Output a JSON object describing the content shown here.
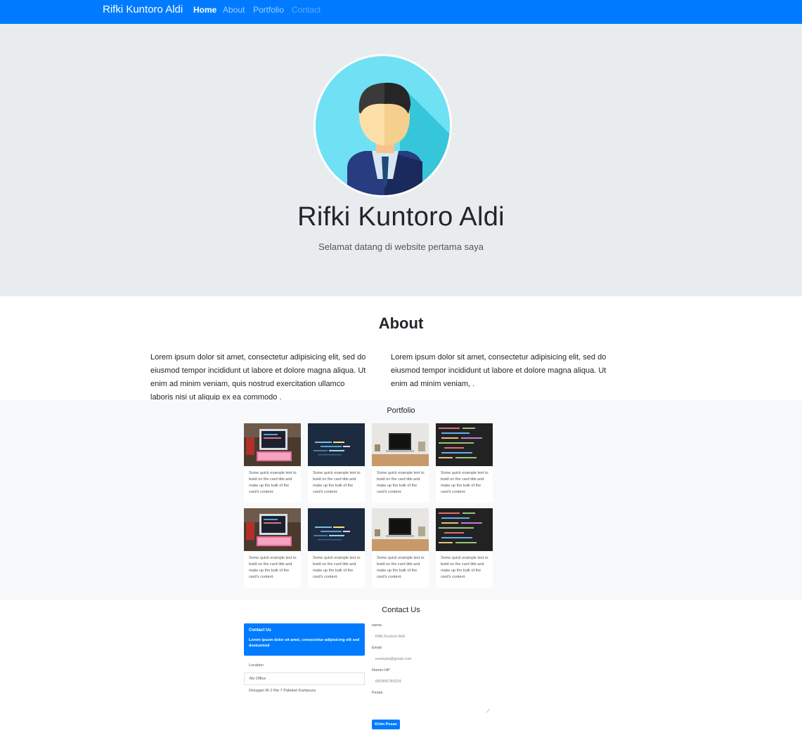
{
  "navbar": {
    "brand": "Rifki Kuntoro Aldi",
    "links": [
      {
        "label": "Home",
        "state": "active"
      },
      {
        "label": "About",
        "state": "muted"
      },
      {
        "label": "Portfolio",
        "state": "muted"
      },
      {
        "label": "Contact",
        "state": "dim"
      }
    ],
    "color": "#007bff"
  },
  "hero": {
    "name": "Rifki Kuntoro Aldi",
    "subtitle": "Selamat datang di website pertama saya",
    "avatar_icon": "businessman-avatar-icon"
  },
  "about": {
    "title": "About",
    "col1": "Lorem ipsum dolor sit amet, consectetur adipisicing elit, sed do eiusmod tempor incididunt ut labore et dolore magna aliqua. Ut enim ad minim veniam, quis nostrud exercitation ullamco laboris nisi ut aliquip ex ea commodo .",
    "col2": "Lorem ipsum dolor sit amet, consectetur adipisicing elit, sed do eiusmod tempor incididunt ut labore et dolore magna aliqua. Ut enim ad minim veniam, ."
  },
  "portfolio": {
    "title": "Portfolio",
    "card_text": "Some quick example text to build on the card title and make up the bulk of the card's content.",
    "cards": [
      {
        "image": "laptop-keyboard-image"
      },
      {
        "image": "code-screen-blue-image"
      },
      {
        "image": "macbook-desk-image"
      },
      {
        "image": "code-dark-image"
      },
      {
        "image": "laptop-keyboard-image"
      },
      {
        "image": "code-screen-blue-image"
      },
      {
        "image": "macbook-desk-image"
      },
      {
        "image": "code-dark-image"
      }
    ]
  },
  "contact": {
    "title": "Contact Us",
    "card_heading": "Contact Us",
    "card_text": "Lorem ipsum dolor sit amet, consectetur adipisicing elit sed doeiusmod",
    "location_label": "Location",
    "office": "My Office",
    "address": "Desagan Rt 2 Rw 7 Pabelan Kartasura",
    "fields": {
      "name_label": "nama",
      "name_placeholder": "Rifki Kuntoro Aldi",
      "email_label": "Email",
      "email_placeholder": "example@gmail.com",
      "phone_label": "Nomer HP",
      "phone_placeholder": "083456789324",
      "message_label": "Pesan"
    },
    "submit_label": "Kirim Pesan"
  }
}
